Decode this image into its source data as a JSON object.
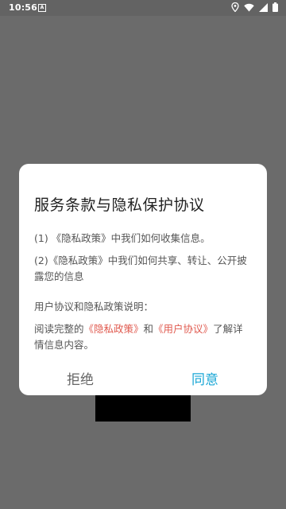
{
  "status_bar": {
    "time": "10:56",
    "notif_letter": "A",
    "icons": [
      "location-icon",
      "wifi-icon",
      "signal-icon",
      "battery-icon"
    ]
  },
  "dialog": {
    "title": "服务条款与隐私保护协议",
    "item1": "(1) 《隐私政策》中我们如何收集信息。",
    "item2": "(2)《隐私政策》中我们如何共享、转让、公开披露您的信息",
    "explain_heading": "用户协议和隐私政策说明：",
    "read_prefix": "阅读完整的",
    "privacy_link": "《隐私政策》",
    "and_text": "和",
    "user_link": "《用户协议》",
    "read_suffix": "了解详情信息内容。",
    "reject_label": "拒绝",
    "agree_label": "同意"
  },
  "colors": {
    "link": "#e05a4f",
    "agree": "#1aa7d6",
    "overlay": "#6b6b6b"
  }
}
